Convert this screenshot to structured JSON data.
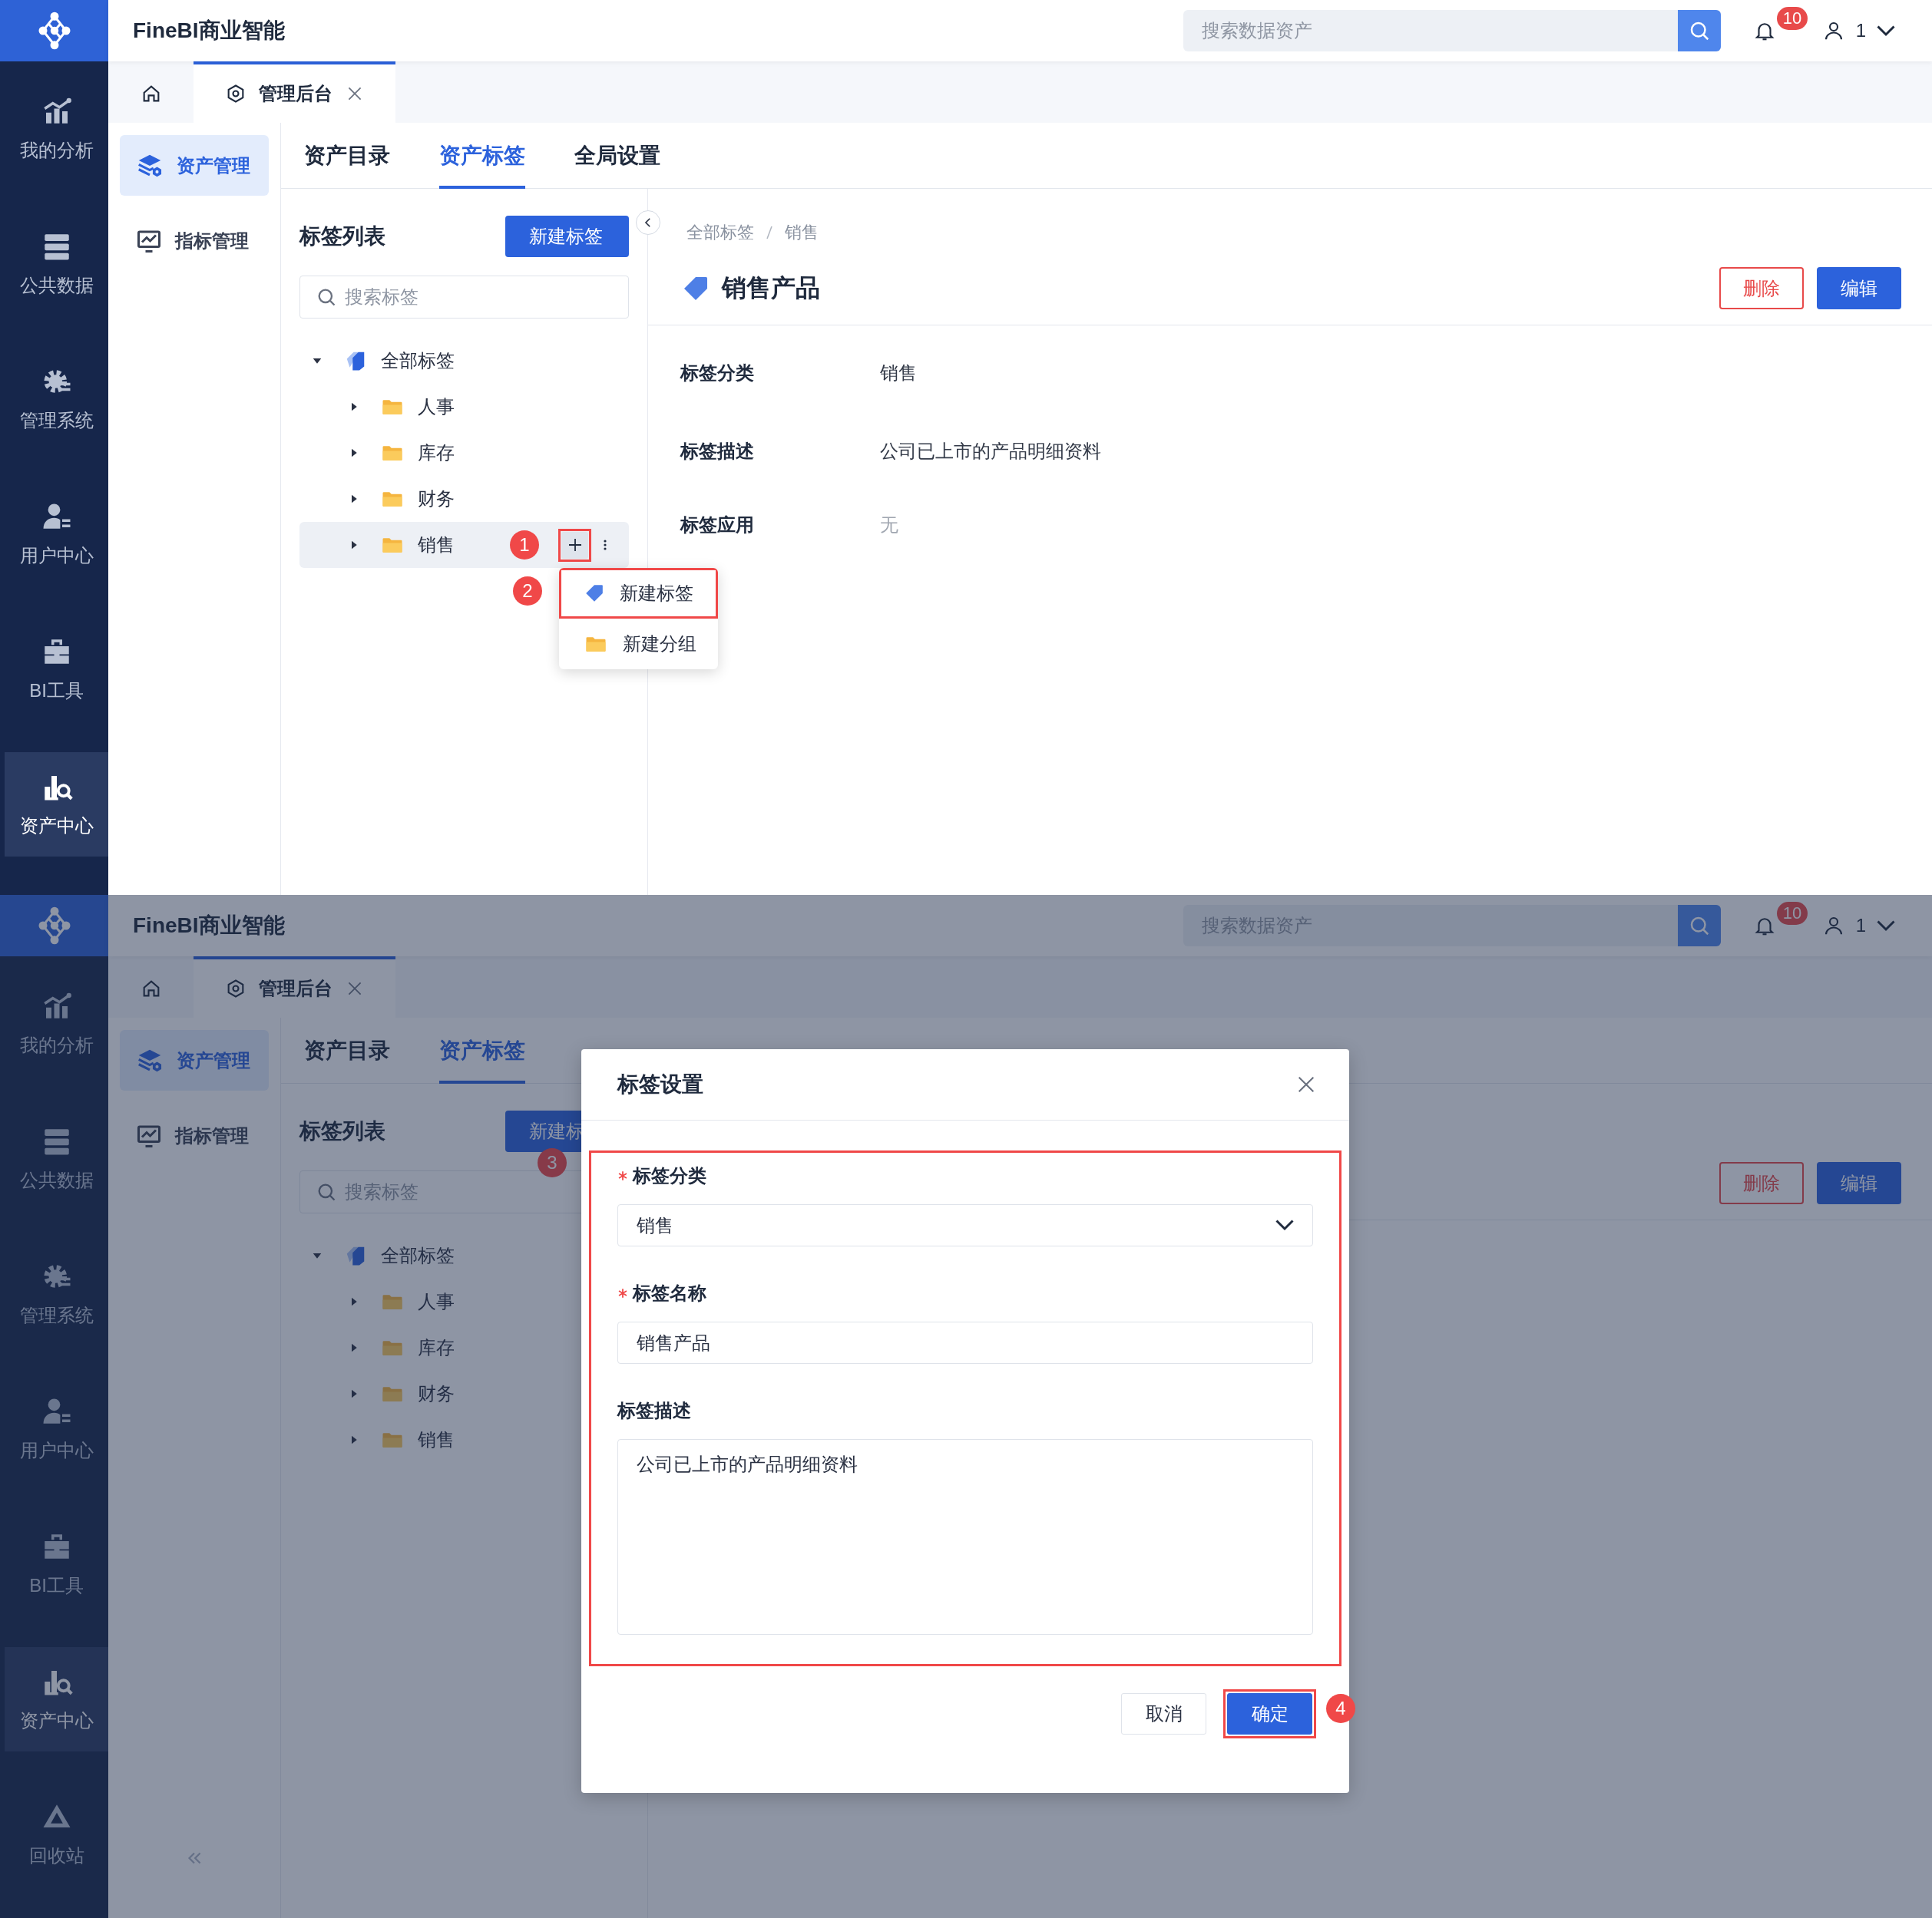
{
  "screens": [
    {
      "app_title": "FineBI商业智能",
      "search": {
        "placeholder": "搜索数据资产"
      },
      "notification_count": "10",
      "user": "1",
      "nav": [
        {
          "label": "我的分析",
          "selected": false
        },
        {
          "label": "公共数据",
          "selected": false
        },
        {
          "label": "管理系统",
          "selected": false
        },
        {
          "label": "用户中心",
          "selected": false
        },
        {
          "label": "BI工具",
          "selected": false
        },
        {
          "label": "资产中心",
          "selected": true
        }
      ],
      "page_tabs": [
        {
          "kind": "home",
          "selected": false
        },
        {
          "kind": "page",
          "label": "管理后台",
          "selected": true
        }
      ],
      "sub_sidebar": {
        "items": [
          {
            "label": "资产管理",
            "selected": true
          },
          {
            "label": "指标管理",
            "selected": false
          }
        ]
      },
      "main_tabs": [
        {
          "label": "资产目录",
          "selected": false
        },
        {
          "label": "资产标签",
          "selected": true
        },
        {
          "label": "全局设置",
          "selected": false
        }
      ],
      "tag_panel": {
        "title": "标签列表",
        "new_button": {
          "label": "新建标签"
        },
        "search": {
          "placeholder": "搜索标签"
        },
        "collapsible": true,
        "tree": [
          {
            "label": "全部标签",
            "expanded": true,
            "selected": false,
            "children": [
              {
                "label": "人事",
                "expanded": false,
                "selected": false
              },
              {
                "label": "库存",
                "expanded": false,
                "selected": false
              },
              {
                "label": "财务",
                "expanded": false,
                "selected": false
              },
              {
                "label": "销售",
                "expanded": false,
                "selected": true,
                "callout": "1",
                "add_highlighted": true,
                "menu": [
                  {
                    "kind": "tag",
                    "label": "新建标签",
                    "highlighted": true,
                    "callout": "2"
                  },
                  {
                    "kind": "folder",
                    "label": "新建分组",
                    "highlighted": false
                  }
                ]
              }
            ]
          }
        ]
      },
      "detail": {
        "breadcrumb": [
          "全部标签",
          "销售"
        ],
        "title": "销售产品",
        "actions": [
          {
            "kind": "danger",
            "label": "删除"
          },
          {
            "kind": "primary",
            "label": "编辑"
          }
        ],
        "fields": [
          {
            "label": "标签分类",
            "value": "销售",
            "muted": false
          },
          {
            "label": "标签描述",
            "value": "公司已上市的产品明细资料",
            "muted": false
          },
          {
            "label": "标签应用",
            "value": "无",
            "muted": true
          }
        ]
      }
    },
    {
      "app_title": "FineBI商业智能",
      "search": {
        "placeholder": "搜索数据资产"
      },
      "notification_count": "10",
      "user": "1",
      "nav": [
        {
          "label": "我的分析",
          "selected": false
        },
        {
          "label": "公共数据",
          "selected": false
        },
        {
          "label": "管理系统",
          "selected": false
        },
        {
          "label": "用户中心",
          "selected": false
        },
        {
          "label": "BI工具",
          "selected": false
        },
        {
          "label": "资产中心",
          "selected": true
        },
        {
          "label": "回收站",
          "selected": false
        }
      ],
      "page_tabs": [
        {
          "kind": "home",
          "selected": false
        },
        {
          "kind": "page",
          "label": "管理后台",
          "selected": true
        }
      ],
      "sub_sidebar": {
        "items": [
          {
            "label": "资产管理",
            "selected": true
          },
          {
            "label": "指标管理",
            "selected": false
          }
        ],
        "collapsible": true
      },
      "main_tabs": [
        {
          "label": "资产目录",
          "selected": false
        },
        {
          "label": "资产标签",
          "selected": true
        }
      ],
      "tag_panel": {
        "title": "标签列表",
        "new_button": {
          "label": "新建标",
          "callout": "3"
        },
        "search": {
          "placeholder": "搜索标签"
        },
        "tree": [
          {
            "label": "全部标签",
            "expanded": true,
            "selected": false,
            "children": [
              {
                "label": "人事",
                "expanded": false,
                "selected": false
              },
              {
                "label": "库存",
                "expanded": false,
                "selected": false
              },
              {
                "label": "财务",
                "expanded": false,
                "selected": false
              },
              {
                "label": "销售",
                "expanded": false,
                "selected": false
              }
            ]
          }
        ]
      },
      "detail": {
        "actions": [
          {
            "kind": "danger",
            "label": "删除"
          },
          {
            "kind": "primary",
            "label": "编辑"
          }
        ]
      },
      "dialog": {
        "title": "标签设置",
        "highlighted": true,
        "fields": [
          {
            "kind": "select",
            "label": "标签分类",
            "required": true,
            "value": "销售"
          },
          {
            "kind": "input",
            "label": "标签名称",
            "required": true,
            "value": "销售产品"
          },
          {
            "kind": "textarea",
            "label": "标签描述",
            "required": false,
            "value": "公司已上市的产品明细资料"
          }
        ],
        "buttons": [
          {
            "kind": "default",
            "label": "取消",
            "highlighted": false
          },
          {
            "kind": "primary",
            "label": "确定",
            "highlighted": true,
            "callout": "4"
          }
        ]
      }
    }
  ]
}
